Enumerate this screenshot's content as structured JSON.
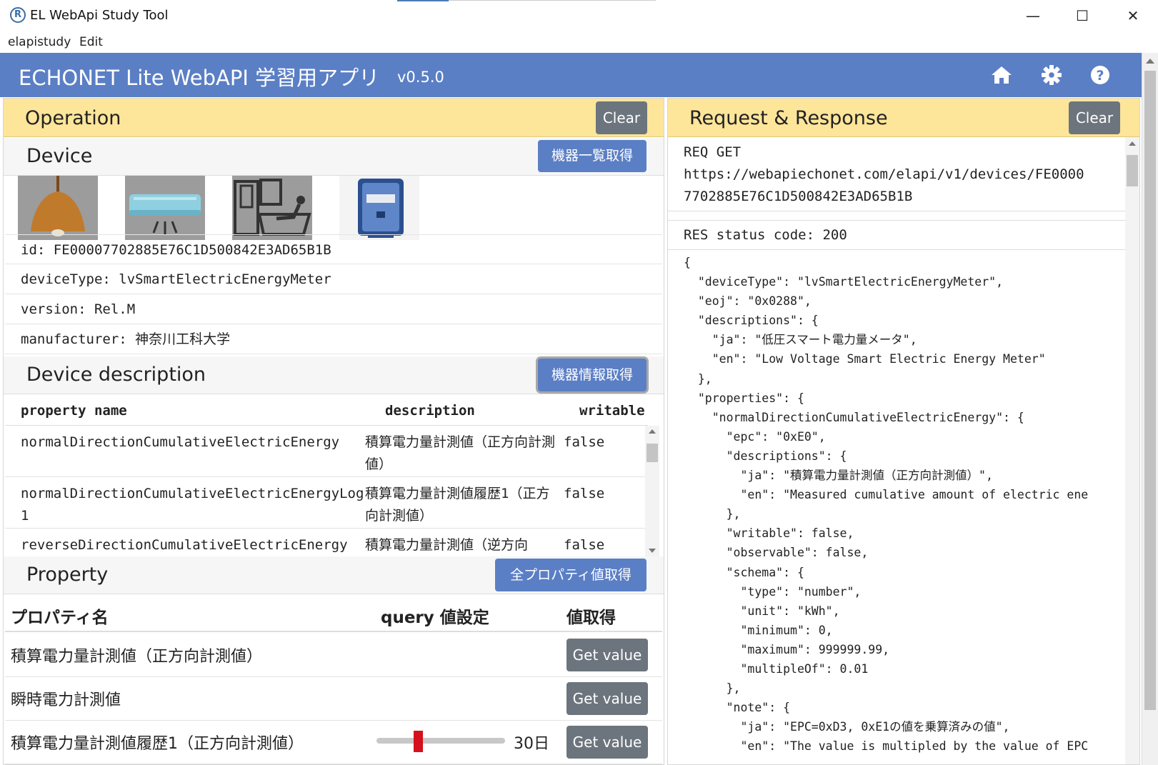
{
  "window": {
    "title": "EL WebApi Study Tool",
    "minimize_glyph": "—",
    "maximize_glyph": "☐",
    "close_glyph": "✕"
  },
  "menu": [
    "elapistudy",
    "Edit"
  ],
  "header": {
    "title": "ECHONET Lite WebAPI 学習用アプリ",
    "version": "v0.5.0",
    "icons": [
      "home-icon",
      "gear-icon",
      "help-icon"
    ],
    "color": "#5b7fc5"
  },
  "operation": {
    "title": "Operation",
    "clear_label": "Clear",
    "device": {
      "title": "Device",
      "button_label": "機器一覧取得",
      "thumbnails": [
        "ceiling-light",
        "air-conditioner",
        "bathroom-heater",
        "smart-electric-meter"
      ],
      "info": {
        "id": "id: FE00007702885E76C1D500842E3AD65B1B",
        "deviceType": "deviceType: lvSmartElectricEnergyMeter",
        "version": "version: Rel.M",
        "manufacturer": "manufacturer: 神奈川工科大学"
      }
    },
    "description": {
      "title": "Device description",
      "button_label": "機器情報取得",
      "columns": [
        "property name",
        "description",
        "writable"
      ],
      "rows": [
        {
          "name": "normalDirectionCumulativeElectricEnergy",
          "desc": "積算電力量計測値（正方向計測値）",
          "writable": "false"
        },
        {
          "name": "normalDirectionCumulativeElectricEnergyLog1",
          "desc": "積算電力量計測値履歴1（正方向計測値）",
          "writable": "false"
        },
        {
          "name": "reverseDirectionCumulativeElectricEnergy",
          "desc": "積算電力量計測値（逆方向",
          "writable": "false"
        }
      ]
    },
    "property": {
      "title": "Property",
      "button_label": "全プロパティ値取得",
      "columns": [
        "プロパティ名",
        "query 値設定",
        "値取得"
      ],
      "rows": [
        {
          "name": "積算電力量計測値（正方向計測値）",
          "button": "Get value"
        },
        {
          "name": "瞬時電力計測値",
          "button": "Get value"
        },
        {
          "name": "積算電力量計測値履歴1（正方向計測値）",
          "button": "Get value",
          "slider_value": "30日",
          "slider_fraction": 0.32
        }
      ]
    }
  },
  "reqres": {
    "title": "Request & Response",
    "clear_label": "Clear",
    "request_line1": "REQ GET",
    "request_line2": "https://webapiechonet.com/elapi/v1/devices/FE0000",
    "request_line3": "7702885E76C1D500842E3AD65B1B",
    "status": "RES status code: 200",
    "json_lines": [
      "{",
      "  \"deviceType\": \"lvSmartElectricEnergyMeter\",",
      "  \"eoj\": \"0x0288\",",
      "  \"descriptions\": {",
      "    \"ja\": \"低圧スマート電力量メータ\",",
      "    \"en\": \"Low Voltage Smart Electric Energy Meter\"",
      "  },",
      "  \"properties\": {",
      "    \"normalDirectionCumulativeElectricEnergy\": {",
      "      \"epc\": \"0xE0\",",
      "      \"descriptions\": {",
      "        \"ja\": \"積算電力量計測値（正方向計測値）\",",
      "        \"en\": \"Measured cumulative amount of electric ene",
      "      },",
      "      \"writable\": false,",
      "      \"observable\": false,",
      "      \"schema\": {",
      "        \"type\": \"number\",",
      "        \"unit\": \"kWh\",",
      "        \"minimum\": 0,",
      "        \"maximum\": 999999.99,",
      "        \"multipleOf\": 0.01",
      "      },",
      "      \"note\": {",
      "        \"ja\": \"EPC=0xD3, 0xE1の値を乗算済みの値\",",
      "        \"en\": \"The value is multipled by the value of EPC"
    ]
  }
}
